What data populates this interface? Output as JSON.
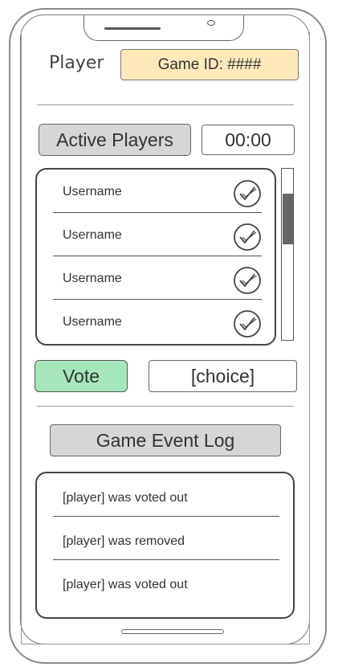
{
  "header": {
    "player_label": "Player",
    "game_id": "Game ID: ####"
  },
  "players_section": {
    "active_players_label": "Active Players",
    "timer": "00:00",
    "players": [
      {
        "username": "Username",
        "icon": "check-icon"
      },
      {
        "username": "Username",
        "icon": "check-icon"
      },
      {
        "username": "Username",
        "icon": "check-icon"
      },
      {
        "username": "Username",
        "icon": "check-icon"
      }
    ]
  },
  "vote": {
    "vote_label": "Vote",
    "choice_value": "[choice]"
  },
  "event_log": {
    "title": "Game Event Log",
    "entries": [
      "[player] was voted out",
      "[player] was removed",
      "[player] was voted out"
    ]
  },
  "colors": {
    "game_id_bg": "#fde9b8",
    "vote_bg": "#a6e6bc",
    "button_gray": "#d6d6d6"
  }
}
